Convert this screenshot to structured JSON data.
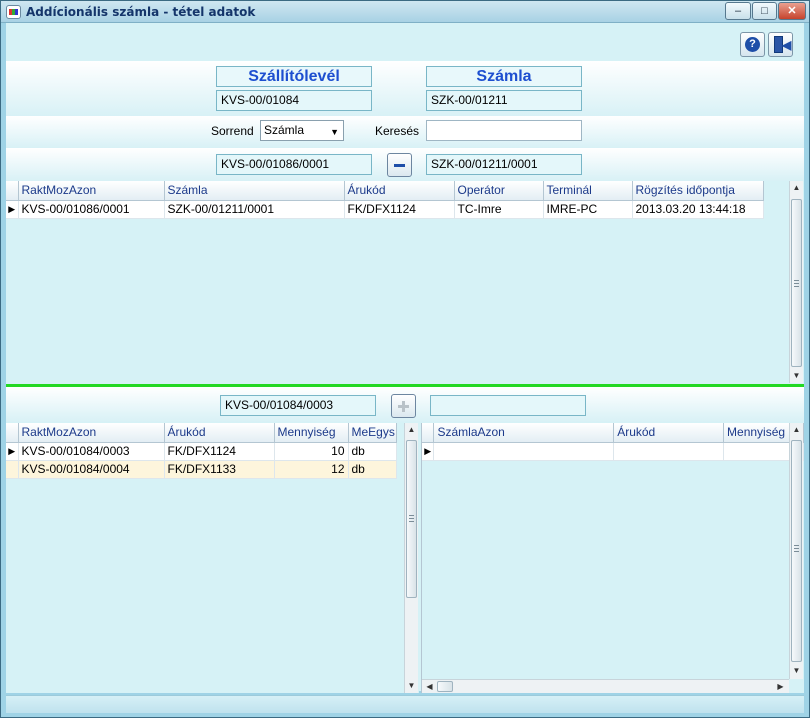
{
  "window": {
    "title": "Addícionális számla - tétel adatok",
    "buttons": {
      "minimize": "‒",
      "maximize": "□",
      "close": "✕"
    }
  },
  "toolbar": {
    "help_icon": "help-icon",
    "exit_icon": "exit-door-icon"
  },
  "header": {
    "left_title": "Szállítólevél",
    "left_value": "KVS-00/01084",
    "right_title": "Számla",
    "right_value": "SZK-00/01211"
  },
  "filter": {
    "sort_label": "Sorrend",
    "sort_value": "Számla",
    "search_label": "Keresés",
    "search_value": ""
  },
  "top_pair": {
    "left": "KVS-00/01086/0001",
    "right": "SZK-00/01211/0001"
  },
  "top_grid": {
    "columns": [
      "RaktMozAzon",
      "Számla",
      "Árukód",
      "Operátor",
      "Terminál",
      "Rögzítés időpontja"
    ],
    "rows": [
      [
        "KVS-00/01086/0001",
        "SZK-00/01211/0001",
        "FK/DFX1124",
        "TC-Imre",
        "IMRE-PC",
        "2013.03.20 13:44:18"
      ]
    ]
  },
  "mid_pair": {
    "left": "KVS-00/01084/0003",
    "right": ""
  },
  "left_grid": {
    "columns": [
      "RaktMozAzon",
      "Árukód",
      "Mennyiség",
      "MeEgys"
    ],
    "rows": [
      [
        "KVS-00/01084/0003",
        "FK/DFX1124",
        "10",
        "db"
      ],
      [
        "KVS-00/01084/0004",
        "FK/DFX1133",
        "12",
        "db"
      ]
    ]
  },
  "right_grid": {
    "columns": [
      "SzámlaAzon",
      "Árukód",
      "Mennyiség"
    ],
    "rows": [
      [
        "",
        "",
        ""
      ]
    ]
  },
  "colors": {
    "accent": "#1d4fd0",
    "separator": "#23d823",
    "background": "#d6f2f6"
  }
}
